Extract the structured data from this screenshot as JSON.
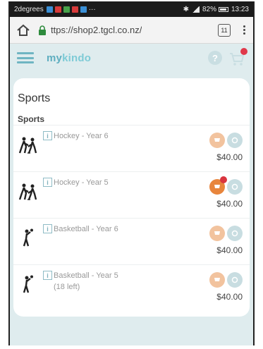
{
  "status_bar": {
    "carrier": "2degrees",
    "battery": "82%",
    "time": "13:23",
    "notification_colors": [
      "#3a8fd6",
      "#d83b3b",
      "#47a24a",
      "#d83b3b",
      "#3a8fd6"
    ],
    "overflow": "···"
  },
  "browser": {
    "url": "ttps://shop2.tgcl.co.nz/",
    "tab_count": "11"
  },
  "app": {
    "brand_part1": "my",
    "brand_part2": "kindo",
    "help_label": "?",
    "accent": "#6fb5c2"
  },
  "content": {
    "section_title": "Sports",
    "subsection_title": "Sports",
    "info_label": "i",
    "items": [
      {
        "name": "Hockey - Year 6",
        "note": "",
        "price": "$40.00",
        "in_cart": false,
        "image": "hockey-players"
      },
      {
        "name": "Hockey - Year 5",
        "note": "",
        "price": "$40.00",
        "in_cart": true,
        "image": "hockey-players"
      },
      {
        "name": "Basketball - Year 6",
        "note": "",
        "price": "$40.00",
        "in_cart": false,
        "image": "basketball-player"
      },
      {
        "name": "Basketball - Year 5",
        "note": "(18 left)",
        "price": "$40.00",
        "in_cart": false,
        "image": "basketball-player"
      }
    ]
  }
}
